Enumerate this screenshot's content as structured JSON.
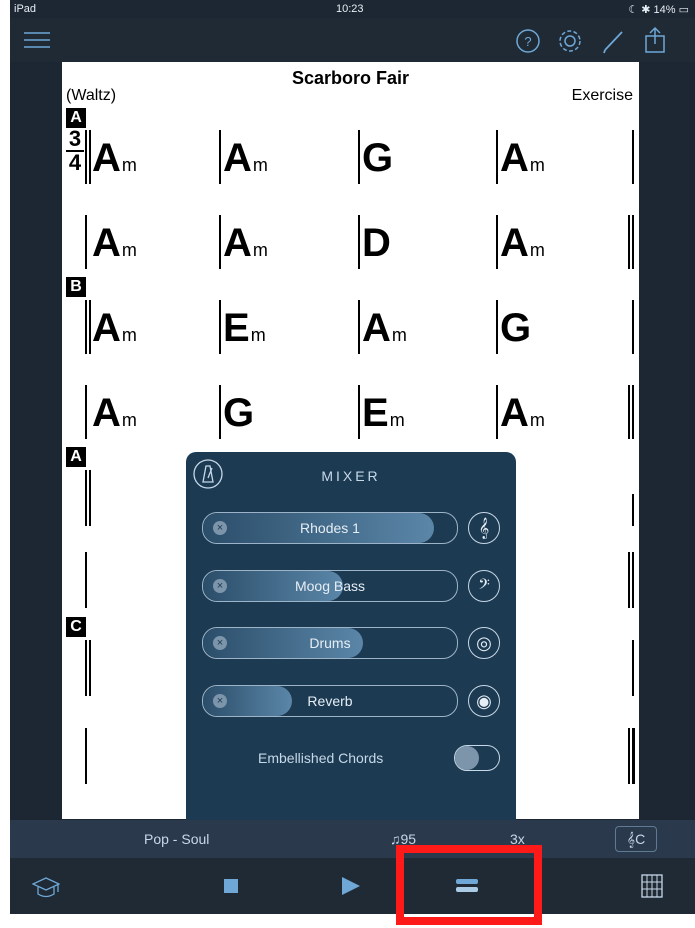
{
  "status": {
    "carrier": "iPad",
    "time": "10:23",
    "battery": "14%"
  },
  "sheet": {
    "title": "Scarboro Fair",
    "style": "(Waltz)",
    "label": "Exercise",
    "time_signature": {
      "top": "3",
      "bottom": "4"
    },
    "rehearsal_marks": [
      "A",
      "B",
      "A",
      "C"
    ],
    "rows": [
      [
        {
          "root": "A",
          "q": "m"
        },
        {
          "root": "A",
          "q": "m"
        },
        {
          "root": "G",
          "q": ""
        },
        {
          "root": "A",
          "q": "m"
        }
      ],
      [
        {
          "root": "A",
          "q": "m"
        },
        {
          "root": "A",
          "q": "m"
        },
        {
          "root": "D",
          "q": ""
        },
        {
          "root": "A",
          "q": "m"
        }
      ],
      [
        {
          "root": "A",
          "q": "m"
        },
        {
          "root": "E",
          "q": "m"
        },
        {
          "root": "A",
          "q": "m"
        },
        {
          "root": "G",
          "q": ""
        }
      ],
      [
        {
          "root": "A",
          "q": "m"
        },
        {
          "root": "G",
          "q": ""
        },
        {
          "root": "E",
          "q": "m"
        },
        {
          "root": "A",
          "q": "m"
        }
      ]
    ]
  },
  "mixer": {
    "title": "MIXER",
    "channels": [
      {
        "name": "Rhodes 1",
        "level": 0.91,
        "icon": "treble-clef-icon",
        "glyph": "𝄞"
      },
      {
        "name": "Moog Bass",
        "level": 0.55,
        "icon": "bass-clef-icon",
        "glyph": "𝄢"
      },
      {
        "name": "Drums",
        "level": 0.63,
        "icon": "drum-icon",
        "glyph": "◎"
      },
      {
        "name": "Reverb",
        "level": 0.35,
        "icon": "reverb-icon",
        "glyph": "◉"
      }
    ],
    "embellished_label": "Embellished Chords",
    "embellished_on": false
  },
  "info": {
    "style": "Pop - Soul",
    "tempo": "95",
    "repeats": "3x",
    "key": "C"
  },
  "colors": {
    "accent": "#ff1a1a",
    "panel": "#1c3a52"
  }
}
